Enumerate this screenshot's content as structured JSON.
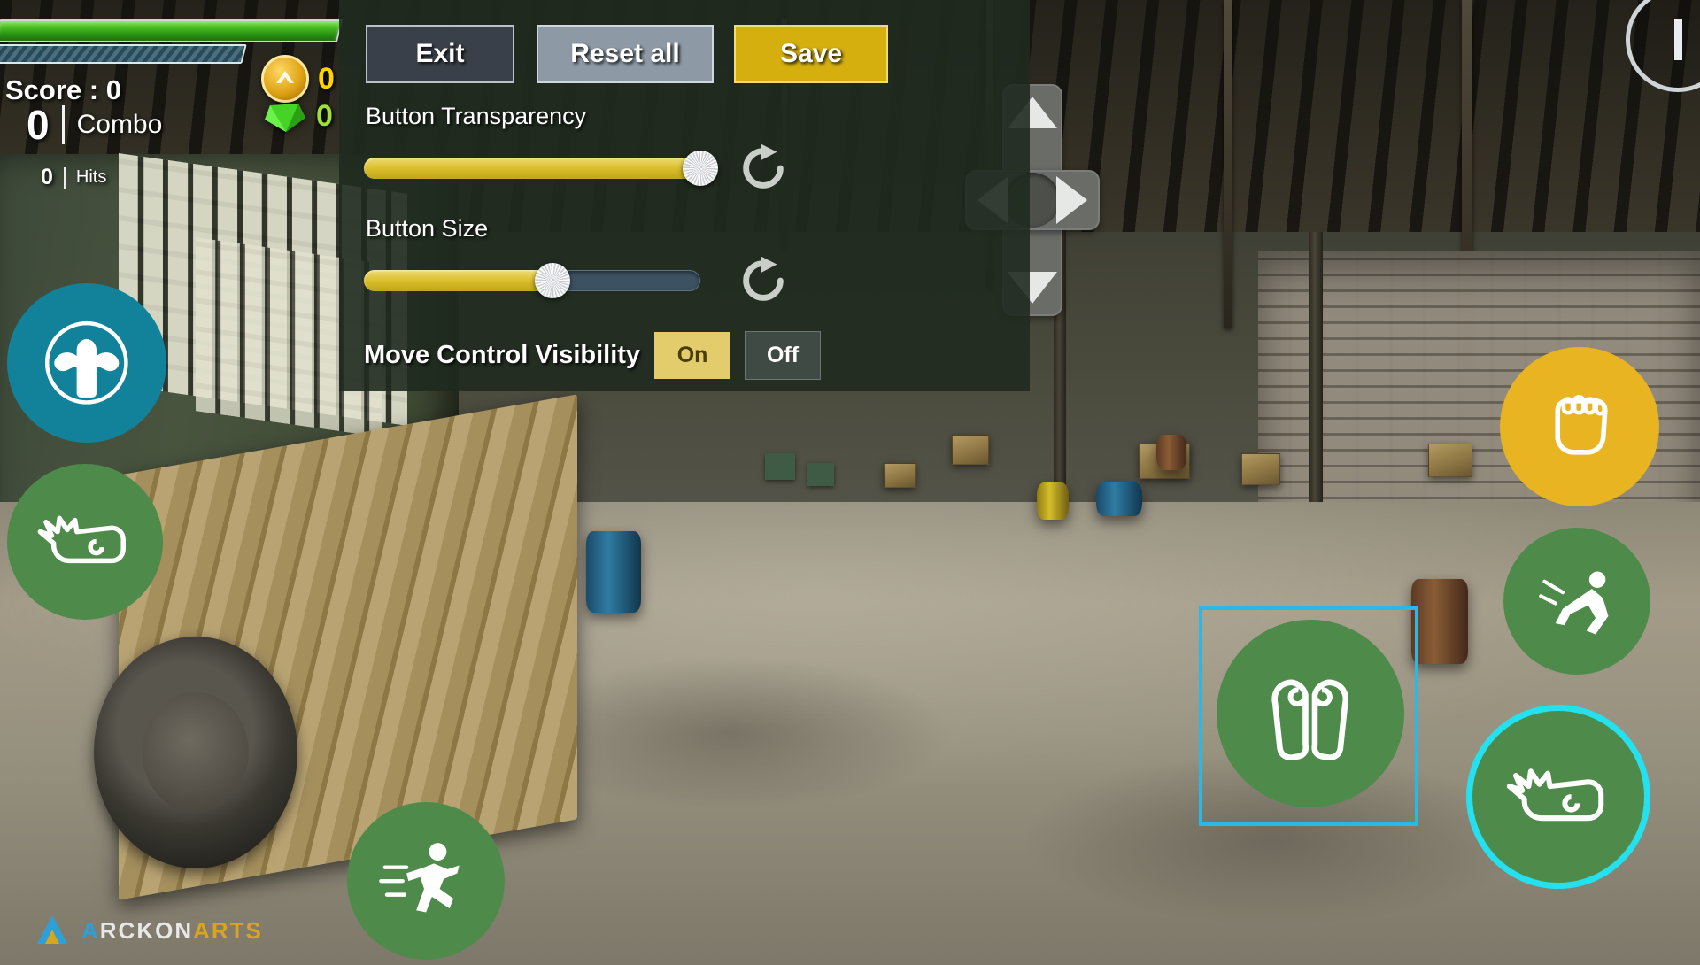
{
  "hud": {
    "score_label": "Score : 0",
    "combo_value": "0",
    "combo_label": "Combo",
    "hits_value": "0",
    "hits_label": "Hits",
    "coin_count": "0",
    "gem_count": "0",
    "health_percent": 100,
    "stamina_percent": 100,
    "coin_icon": "coin-icon",
    "gem_icon": "gem-icon"
  },
  "panel": {
    "buttons": {
      "exit": "Exit",
      "reset_all": "Reset all",
      "save": "Save"
    },
    "transparency": {
      "label": "Button Transparency",
      "value": 100,
      "reset_icon": "reset-icon"
    },
    "size": {
      "label": "Button Size",
      "value": 56,
      "reset_icon": "reset-icon"
    },
    "visibility": {
      "label": "Move Control Visibility",
      "on": "On",
      "off": "Off",
      "selected": "On"
    },
    "colors": {
      "accent_yellow": "#d4af0e",
      "slider_fill": "#d8bc28",
      "slider_track": "#3c5263",
      "panel_bg": "#1f2a1f",
      "selection": "#2bb8e6"
    }
  },
  "dpad": {
    "up": "dpad-up",
    "down": "dpad-down",
    "left": "dpad-left",
    "right": "dpad-right",
    "center": "dpad-center"
  },
  "pause": {
    "name": "pause-button"
  },
  "action_buttons": [
    {
      "id": "power-flex",
      "icon": "flex-muscle-icon",
      "color": "#12829b",
      "selected": false
    },
    {
      "id": "punch-left",
      "icon": "fist-punch-icon",
      "color": "#4e8a4a",
      "selected": false
    },
    {
      "id": "run",
      "icon": "running-man-icon",
      "color": "#4e8a4a",
      "selected": false
    },
    {
      "id": "block",
      "icon": "guard-arms-icon",
      "color": "#4e8a4a",
      "selected": true
    },
    {
      "id": "kick",
      "icon": "foot-kick-icon",
      "color": "#e8b422",
      "selected": false
    },
    {
      "id": "dive",
      "icon": "dive-attack-icon",
      "color": "#4e8a4a",
      "selected": false
    },
    {
      "id": "punch-right",
      "icon": "fist-punch-icon",
      "color": "#4e8a4a",
      "selected": false
    }
  ],
  "logo": {
    "part1": "A",
    "part2": "RCKON",
    "part3": "ARTS"
  }
}
